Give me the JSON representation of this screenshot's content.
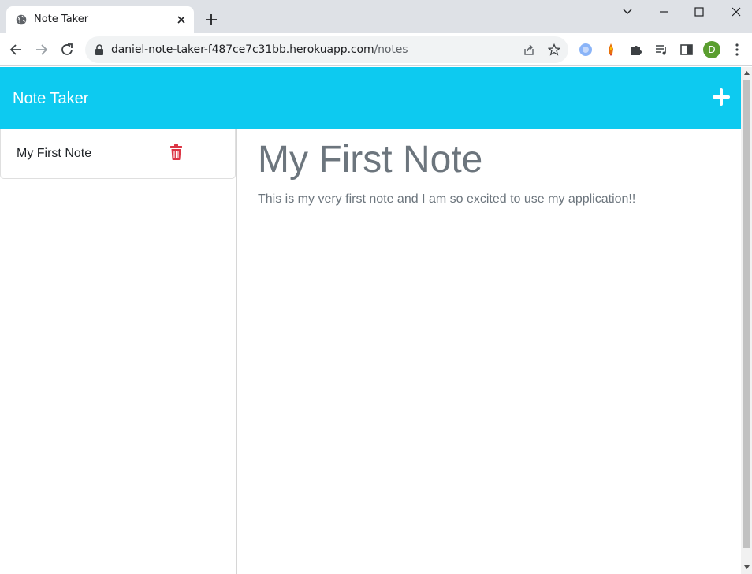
{
  "browser": {
    "tab_title": "Note Taker",
    "url_host": "daniel-note-taker-f487ce7c31bb.herokuapp.com",
    "url_path": "/notes",
    "profile_initial": "D",
    "profile_color": "#5a9e2f"
  },
  "app": {
    "brand": "Note Taker",
    "navbar_color": "#0dcaf0",
    "notes": [
      {
        "title": "My First Note"
      }
    ],
    "active_note": {
      "title": "My First Note",
      "text": "This is my very first note and I am so excited to use my application!!"
    },
    "delete_color": "#dc3545"
  },
  "icons": {
    "favicon": "globe-icon",
    "add": "plus-icon",
    "delete": "trash-icon"
  }
}
